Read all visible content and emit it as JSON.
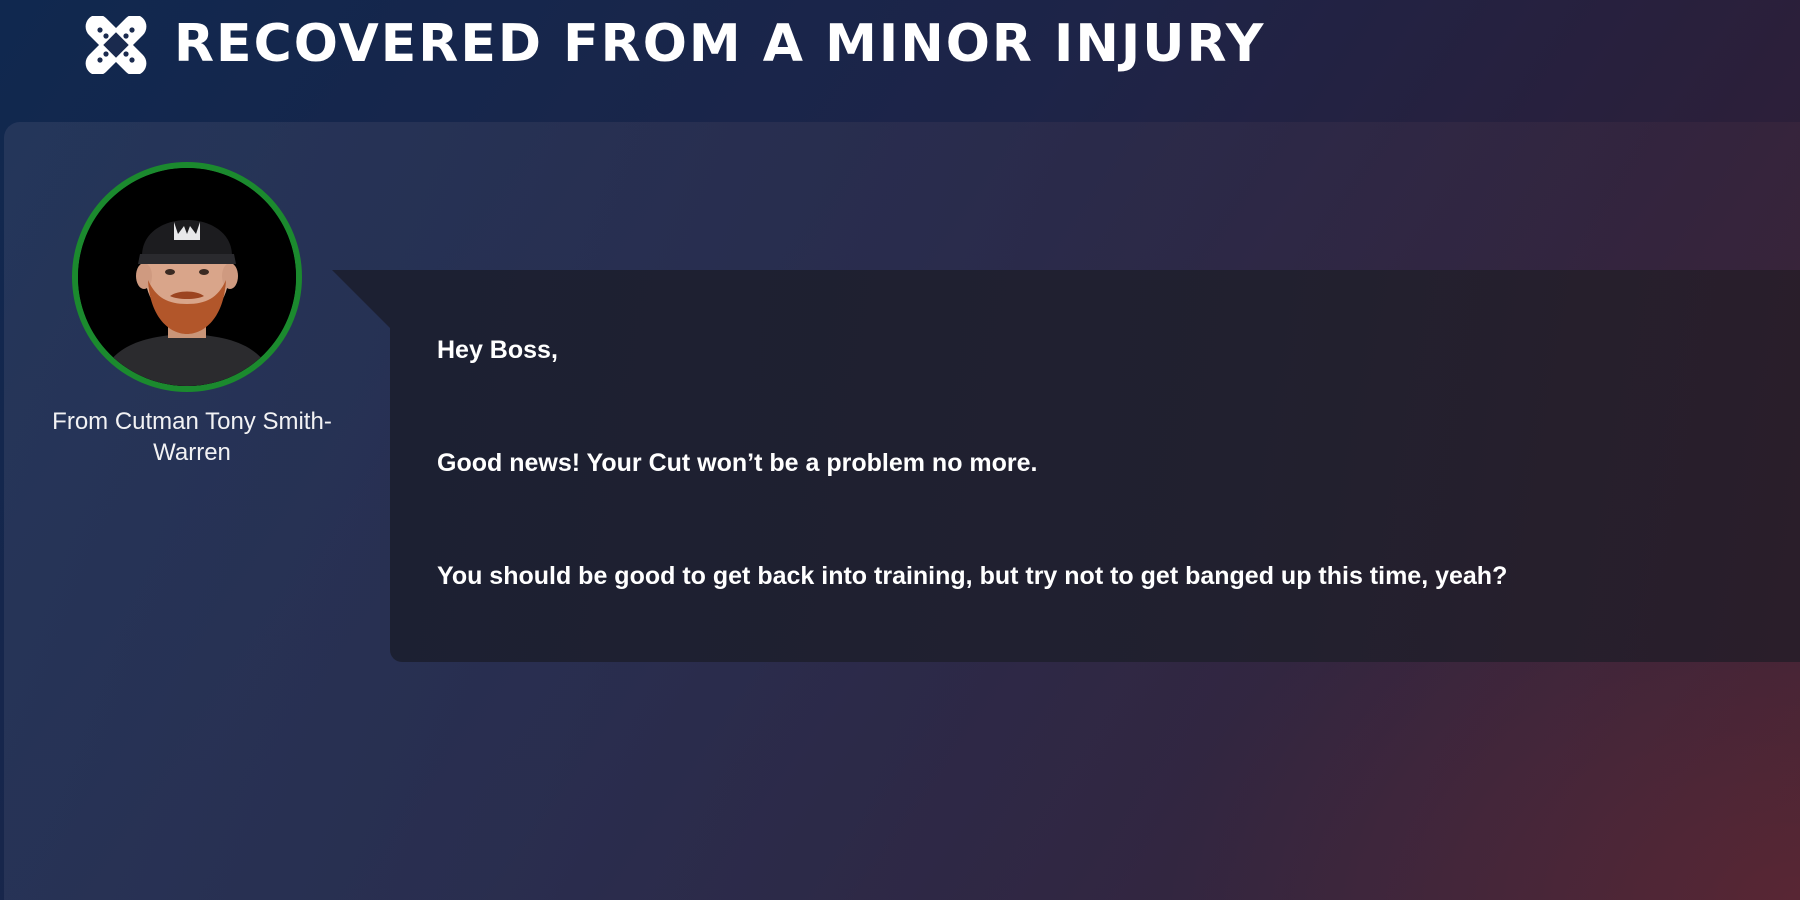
{
  "header": {
    "icon": "bandage-icon",
    "title": "RECOVERED FROM A MINOR INJURY"
  },
  "sender": {
    "avatar": "cutman-portrait",
    "avatar_ring_color": "#1b8a2e",
    "name": "From Cutman Tony Smith-Warren"
  },
  "message": {
    "lines": [
      "Hey Boss,",
      "Good news! Your Cut won’t be a problem no more.",
      "You should be good to get back into training, but try not to get banged up this time, yeah?"
    ]
  }
}
